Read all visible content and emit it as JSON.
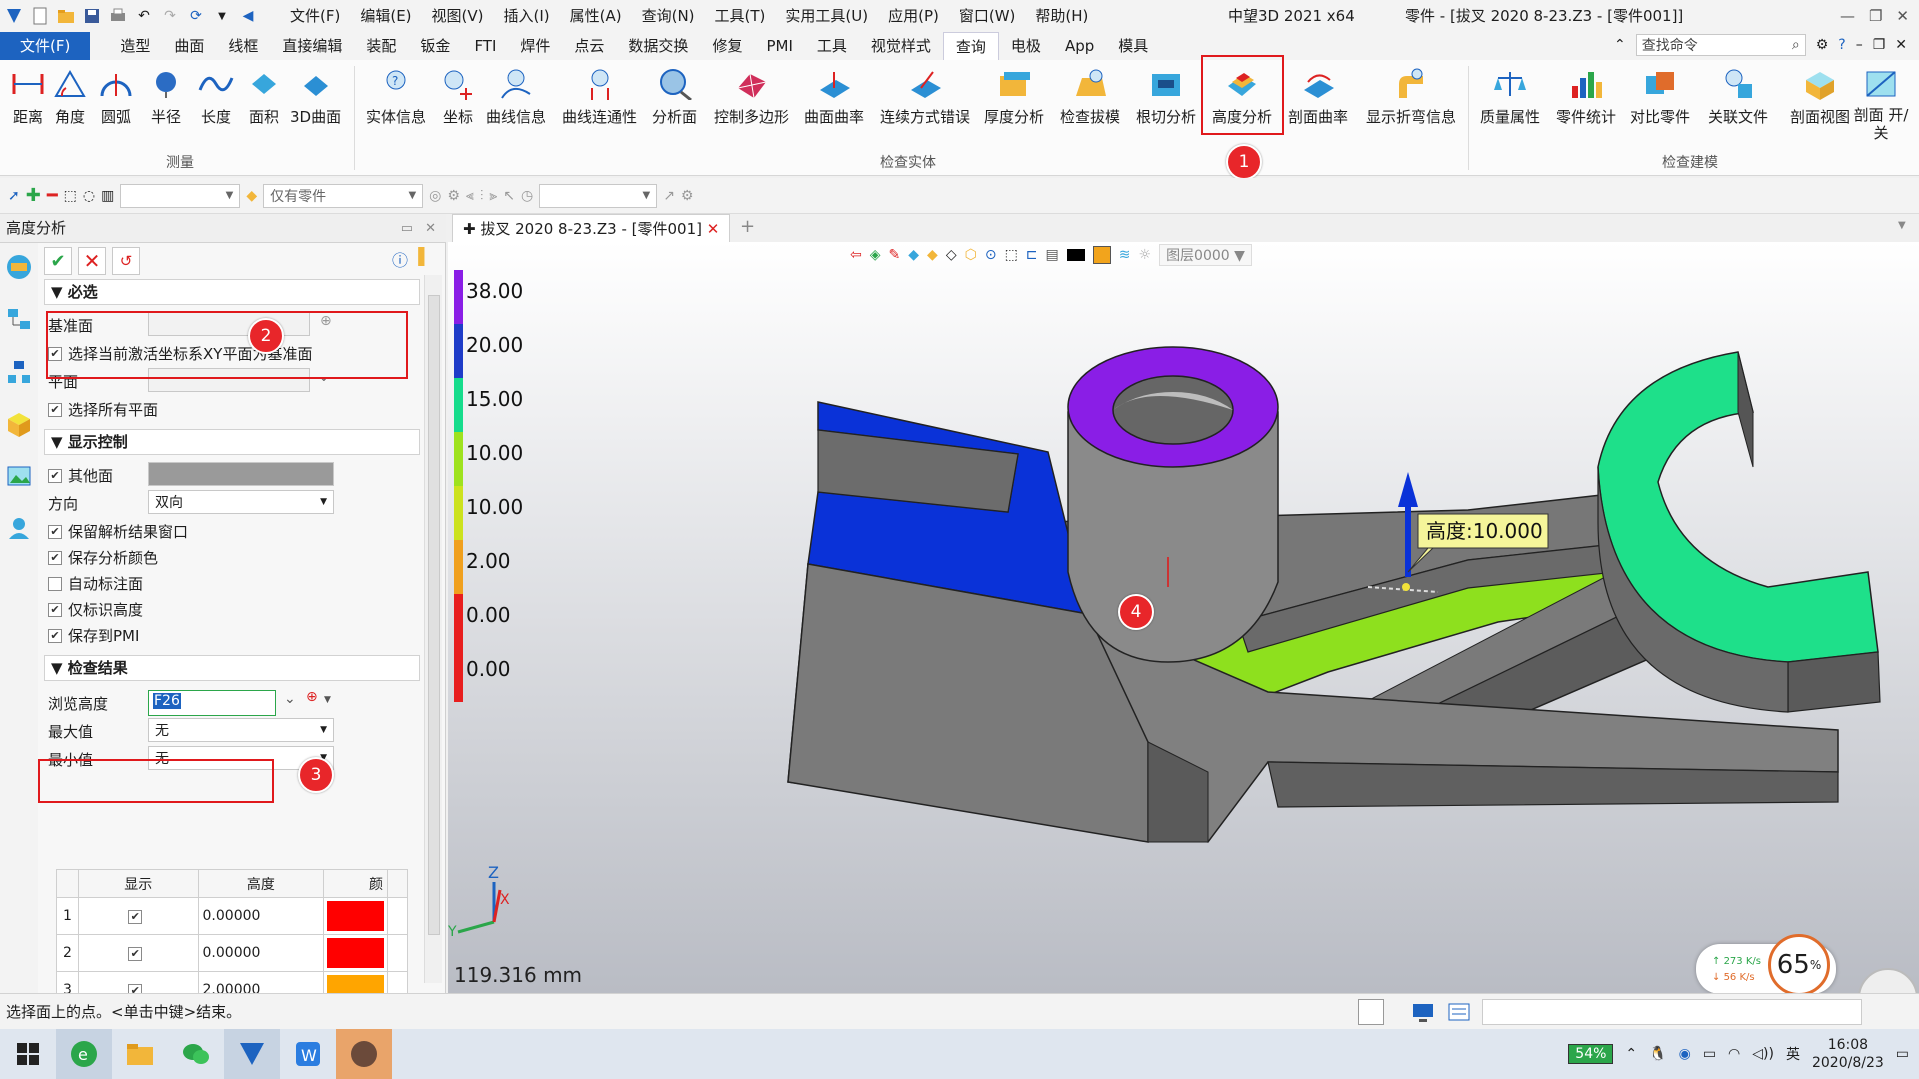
{
  "titlebar": {
    "menus": [
      "文件(F)",
      "编辑(E)",
      "视图(V)",
      "插入(I)",
      "属性(A)",
      "查询(N)",
      "工具(T)",
      "实用工具(U)",
      "应用(P)",
      "窗口(W)",
      "帮助(H)"
    ],
    "app": "中望3D 2021 x64",
    "document": "零件 - [拔叉  2020  8-23.Z3 - [零件001]]"
  },
  "ribbon_tabs": [
    "文件(F)",
    "造型",
    "曲面",
    "线框",
    "直接编辑",
    "装配",
    "钣金",
    "FTI",
    "焊件",
    "点云",
    "数据交换",
    "修复",
    "PMI",
    "工具",
    "视觉样式",
    "查询",
    "电极",
    "App",
    "模具"
  ],
  "active_tab": "查询",
  "search": {
    "placeholder": "查找命令"
  },
  "ribbon": {
    "measure": [
      "距离",
      "角度",
      "圆弧",
      "半径",
      "长度",
      "面积",
      "3D曲面"
    ],
    "inspect": [
      "实体信息",
      "坐标",
      "曲线信息",
      "曲线连通性",
      "分析面",
      "控制多边形",
      "曲面曲率",
      "连续方式错误",
      "厚度分析",
      "检查拔模",
      "根切分析",
      "高度分析",
      "剖面曲率",
      "显示折弯信息"
    ],
    "model": [
      "质量属性",
      "零件统计",
      "对比零件",
      "关联文件",
      "剖面视图",
      "剖面 开/关"
    ],
    "group_measure": "测量",
    "group_inspect": "检查实体",
    "group_model": "检查建模"
  },
  "toolbar2": {
    "filter": "仅有零件"
  },
  "panel": {
    "title": "高度分析",
    "sec_required": "必选",
    "base_face": "基准面",
    "use_xy": "选择当前激活坐标系XY平面为基准面",
    "plane": "平面",
    "all_planes": "选择所有平面",
    "sec_display": "显示控制",
    "other_face": "其他面",
    "direction": "方向",
    "direction_value": "双向",
    "keep_window": "保留解析结果窗口",
    "save_color": "保存分析颜色",
    "auto_mark": "自动标注面",
    "only_height": "仅标识高度",
    "save_pmi": "保存到PMI",
    "sec_results": "检查结果",
    "browse": "浏览高度",
    "browse_value": "F26",
    "max": "最大值",
    "max_value": "无",
    "min": "最小值",
    "min_value": "无",
    "table_headers": [
      "显示",
      "高度",
      "颜"
    ],
    "rows": [
      {
        "idx": "1",
        "height": "0.00000",
        "color": "#ff0000"
      },
      {
        "idx": "2",
        "height": "0.00000",
        "color": "#ff0000"
      },
      {
        "idx": "3",
        "height": "2.00000",
        "color": "#ffa500"
      }
    ]
  },
  "viewport": {
    "doc_tab": "拔叉  2020  8-23.Z3 - [零件001]",
    "layer": "图层0000",
    "scale_values": [
      "38.00",
      "20.00",
      "15.00",
      "10.00",
      "10.00",
      "2.00",
      "0.00",
      "0.00"
    ],
    "scale_colors": [
      "#8a1ee6",
      "#1e3cc8",
      "#16dc8c",
      "#9ee21e",
      "#cce21e",
      "#f0a01e",
      "#e81e1e",
      "#e81e1e"
    ],
    "height_label": "高度:10.000",
    "dimension": "119.316 mm",
    "speed_up": "273 K/s",
    "speed_down": "56 K/s",
    "percent": "65",
    "percent_unit": "%"
  },
  "markers": [
    "1",
    "2",
    "3",
    "4"
  ],
  "statusbar": {
    "hint": "选择面上的点。<单击中键>结束。"
  },
  "taskbar": {
    "battery": "54%",
    "time": "16:08",
    "date": "2020/8/23"
  }
}
